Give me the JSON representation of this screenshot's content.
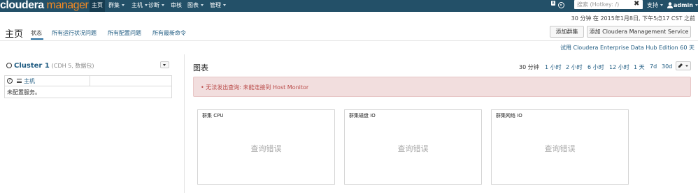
{
  "navbar": {
    "logo_part1": "cloudera",
    "logo_part2": "manager",
    "items": [
      {
        "label": "主页",
        "has_caret": false,
        "active": true
      },
      {
        "label": "群集",
        "has_caret": true
      },
      {
        "label": "主机",
        "has_caret": true
      },
      {
        "label": "诊断",
        "has_caret": true
      },
      {
        "label": "审核",
        "has_caret": false
      },
      {
        "label": "图表",
        "has_caret": true
      },
      {
        "label": "管理",
        "has_caret": true
      }
    ],
    "notification_count": "8",
    "search_placeholder": "搜索 (Hotkey: /)",
    "support_label": "支持",
    "user_label": "admin"
  },
  "subheader": {
    "time_info": "30 分钟 在 2015年1月8日, 下午5点17 CST 之前",
    "page_title": "主页",
    "tabs": [
      "状态",
      "所有运行状况问题",
      "所有配置问题",
      "所有最新命令"
    ],
    "add_cluster_button": "添加群集",
    "add_cms_button": "添加 Cloudera Management Service",
    "trial_link": "试用 Cloudera Enterprise Data Hub Edition 60 天"
  },
  "cluster": {
    "name": "Cluster 1",
    "subtitle": "(CDH 5, 数据包)",
    "hosts_link": "主机",
    "no_services": "未配置服务。"
  },
  "charts": {
    "title": "图表",
    "time_ranges": [
      "30 分钟",
      "1 小时",
      "2 小时",
      "6 小时",
      "12 小时",
      "1 天",
      "7d",
      "30d"
    ],
    "selected_range": "30 分钟",
    "error_message": "无法发出查询: 未能连接到 Host Monitor",
    "cards": [
      {
        "title": "群集 CPU",
        "status": "查询错误"
      },
      {
        "title": "群集磁盘 IO",
        "status": "查询错误"
      },
      {
        "title": "群集网络 IO",
        "status": "查询错误"
      }
    ]
  },
  "colors": {
    "navbar_bg": "#235068",
    "logo_accent": "#f58a22",
    "link": "#1d5a80",
    "alert_bg": "#f2dede",
    "alert_text": "#b94a48"
  }
}
